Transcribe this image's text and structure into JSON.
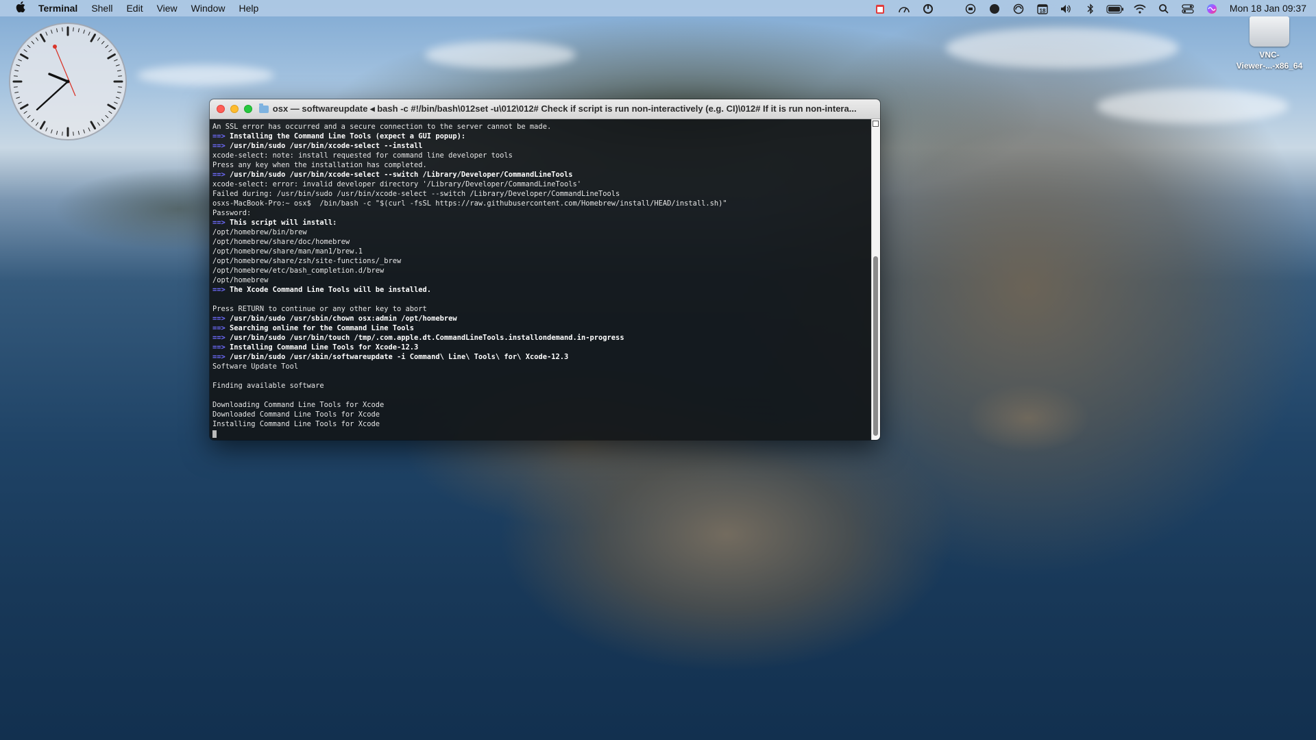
{
  "menubar": {
    "apple_glyph": "",
    "app_name": "Terminal",
    "items": [
      "Shell",
      "Edit",
      "View",
      "Window",
      "Help"
    ],
    "status_icons": [
      "calendar-badge-icon",
      "speedometer-icon",
      "power-icon",
      "lock-ring-icon",
      "compass-icon",
      "refresh-icon",
      "date-icon",
      "volume-icon",
      "bluetooth-icon",
      "battery-icon",
      "wifi-icon",
      "search-icon",
      "control-center-icon",
      "siri-icon"
    ],
    "date_badge": "18",
    "datetime": "Mon 18 Jan  09:37"
  },
  "desktop": {
    "drive_label_line1": "VNC-",
    "drive_label_line2": "Viewer-...-x86_64"
  },
  "terminal": {
    "title": "osx — softwareupdate ◂ bash -c #!/bin/bash\\012set -u\\012\\012# Check if script is run non-interactively (e.g. CI)\\012# If it is run non-intera...",
    "lines": [
      {
        "text": "An SSL error has occurred and a secure connection to the server cannot be made.",
        "arrow": false,
        "bold": false
      },
      {
        "text": "Installing the Command Line Tools (expect a GUI popup):",
        "arrow": true,
        "bold": true
      },
      {
        "text": "/usr/bin/sudo /usr/bin/xcode-select --install",
        "arrow": true,
        "bold": true
      },
      {
        "text": "xcode-select: note: install requested for command line developer tools",
        "arrow": false,
        "bold": false
      },
      {
        "text": "Press any key when the installation has completed.",
        "arrow": false,
        "bold": false
      },
      {
        "text": "/usr/bin/sudo /usr/bin/xcode-select --switch /Library/Developer/CommandLineTools",
        "arrow": true,
        "bold": true
      },
      {
        "text": "xcode-select: error: invalid developer directory '/Library/Developer/CommandLineTools'",
        "arrow": false,
        "bold": false
      },
      {
        "text": "Failed during: /usr/bin/sudo /usr/bin/xcode-select --switch /Library/Developer/CommandLineTools",
        "arrow": false,
        "bold": false
      },
      {
        "text": "osxs-MacBook-Pro:~ osx$  /bin/bash -c \"$(curl -fsSL https://raw.githubusercontent.com/Homebrew/install/HEAD/install.sh)\"",
        "arrow": false,
        "bold": false
      },
      {
        "text": "Password:",
        "arrow": false,
        "bold": false
      },
      {
        "text": "This script will install:",
        "arrow": true,
        "bold": true
      },
      {
        "text": "/opt/homebrew/bin/brew",
        "arrow": false,
        "bold": false
      },
      {
        "text": "/opt/homebrew/share/doc/homebrew",
        "arrow": false,
        "bold": false
      },
      {
        "text": "/opt/homebrew/share/man/man1/brew.1",
        "arrow": false,
        "bold": false
      },
      {
        "text": "/opt/homebrew/share/zsh/site-functions/_brew",
        "arrow": false,
        "bold": false
      },
      {
        "text": "/opt/homebrew/etc/bash_completion.d/brew",
        "arrow": false,
        "bold": false
      },
      {
        "text": "/opt/homebrew",
        "arrow": false,
        "bold": false
      },
      {
        "text": "The Xcode Command Line Tools will be installed.",
        "arrow": true,
        "bold": true
      },
      {
        "text": "",
        "arrow": false,
        "bold": false
      },
      {
        "text": "Press RETURN to continue or any other key to abort",
        "arrow": false,
        "bold": false
      },
      {
        "text": "/usr/bin/sudo /usr/sbin/chown osx:admin /opt/homebrew",
        "arrow": true,
        "bold": true
      },
      {
        "text": "Searching online for the Command Line Tools",
        "arrow": true,
        "bold": true
      },
      {
        "text": "/usr/bin/sudo /usr/bin/touch /tmp/.com.apple.dt.CommandLineTools.installondemand.in-progress",
        "arrow": true,
        "bold": true
      },
      {
        "text": "Installing Command Line Tools for Xcode-12.3",
        "arrow": true,
        "bold": true
      },
      {
        "text": "/usr/bin/sudo /usr/sbin/softwareupdate -i Command\\ Line\\ Tools\\ for\\ Xcode-12.3",
        "arrow": true,
        "bold": true
      },
      {
        "text": "Software Update Tool",
        "arrow": false,
        "bold": false
      },
      {
        "text": "",
        "arrow": false,
        "bold": false
      },
      {
        "text": "Finding available software",
        "arrow": false,
        "bold": false
      },
      {
        "text": "",
        "arrow": false,
        "bold": false
      },
      {
        "text": "Downloading Command Line Tools for Xcode",
        "arrow": false,
        "bold": false
      },
      {
        "text": "Downloaded Command Line Tools for Xcode",
        "arrow": false,
        "bold": false
      },
      {
        "text": "Installing Command Line Tools for Xcode",
        "arrow": false,
        "bold": false
      }
    ],
    "arrow_glyph": "==>",
    "colors": {
      "background": "#121618",
      "text": "#e6e6e6",
      "arrow": "#6f6cff"
    }
  }
}
